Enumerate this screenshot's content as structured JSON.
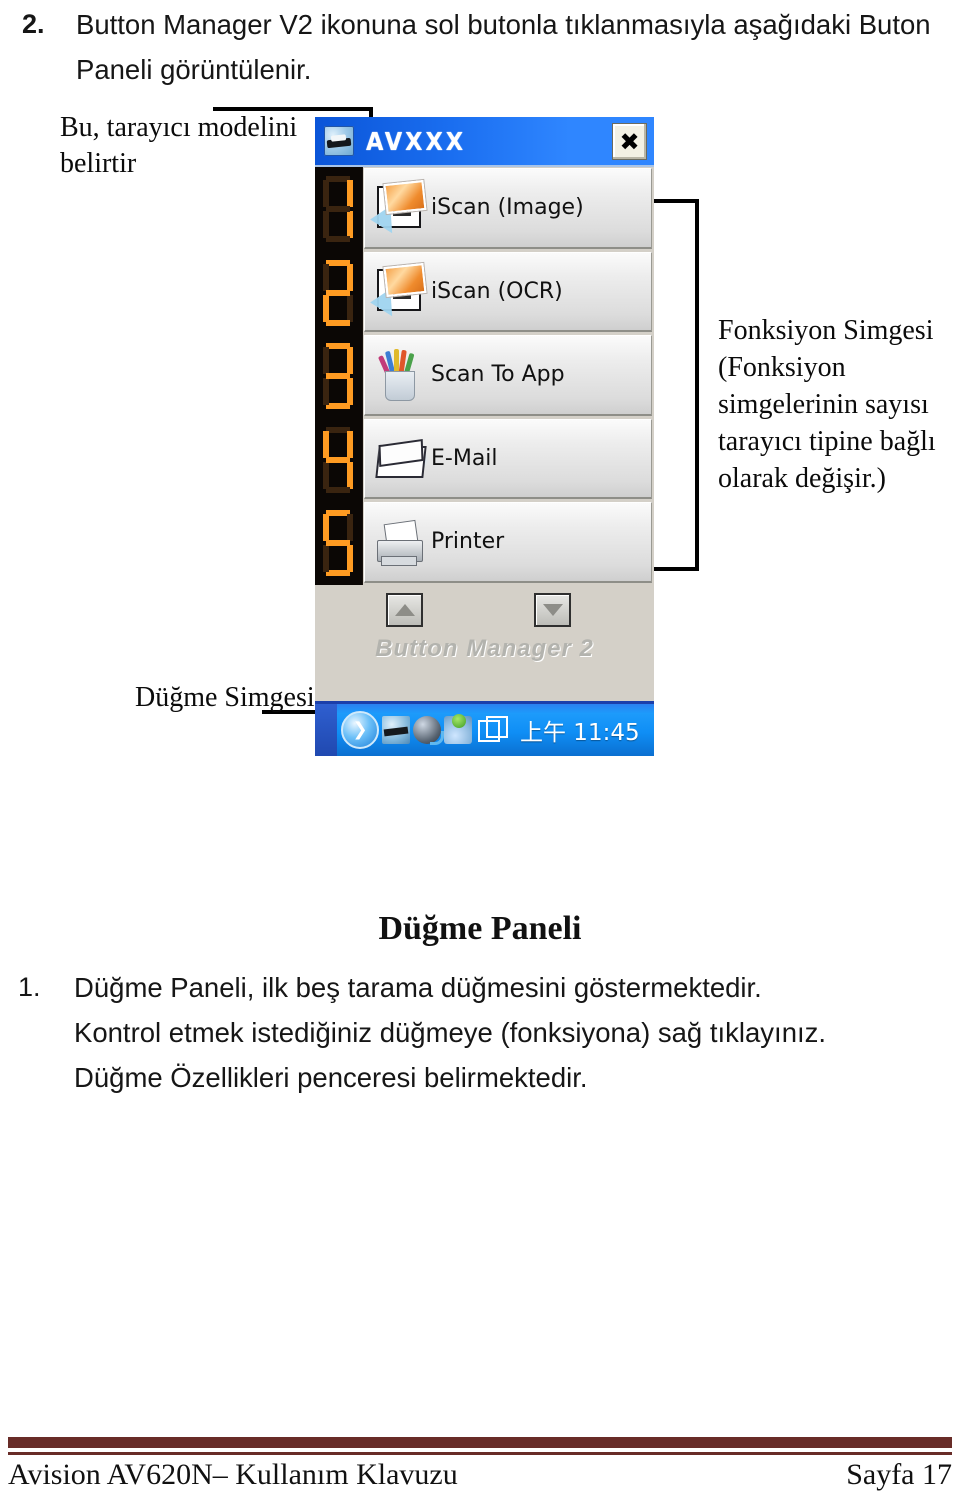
{
  "step2": {
    "number": "2.",
    "text": "Button Manager V2 ikonuna sol butonla tıklanmasıyla aşağıdaki Buton Paneli görüntülenir."
  },
  "annotations": {
    "scanner_model": "Bu, tarayıcı modelini belirtir",
    "button_icon": "Düğme Simgesi",
    "function_icon": "Fonksiyon Simgesi (Fonksiyon simgelerinin sayısı tarayıcı tipine bağlı olarak değişir.)"
  },
  "panel": {
    "title": "AVXXX",
    "title_icon": "scanner-icon",
    "close_label": "✖",
    "brand": "Button Manager 2",
    "scroll_up_icon": "triangle-up-icon",
    "scroll_down_icon": "triangle-down-icon",
    "buttons": [
      {
        "number": "1",
        "label": "iScan (Image)",
        "icon": "photo-scan-icon"
      },
      {
        "number": "2",
        "label": "iScan (OCR)",
        "icon": "photo-scan-icon"
      },
      {
        "number": "3",
        "label": "Scan To App",
        "icon": "pencil-cup-icon"
      },
      {
        "number": "4",
        "label": "E-Mail",
        "icon": "envelope-icon"
      },
      {
        "number": "5",
        "label": "Printer",
        "icon": "printer-icon"
      }
    ],
    "taskbar": {
      "start_icon": "show-hidden-icons-chevron",
      "tray_icons": [
        "scanner-tray-icon",
        "network-tray-icon",
        "safely-remove-tray-icon",
        "windows-tray-icon"
      ],
      "clock": "上午 11:45"
    }
  },
  "section": {
    "title": "Düğme Paneli",
    "item_number": "1.",
    "line1": "Düğme Paneli, ilk beş tarama düğmesini göstermektedir.",
    "line2": "Kontrol etmek istediğiniz düğmeye (fonksiyona) sağ tıklayınız.",
    "line3": "Düğme Özellikleri penceresi belirmektedir."
  },
  "footer": {
    "left": "Avision AV620N– Kullanım Klavuzu",
    "right": "Sayfa 17"
  },
  "colors": {
    "rule": "#682c28",
    "titlebar": "#1a6ef0",
    "led_on": "#ff9b22",
    "led_off": "#3a2410",
    "taskbar": "#0f8ef5"
  }
}
